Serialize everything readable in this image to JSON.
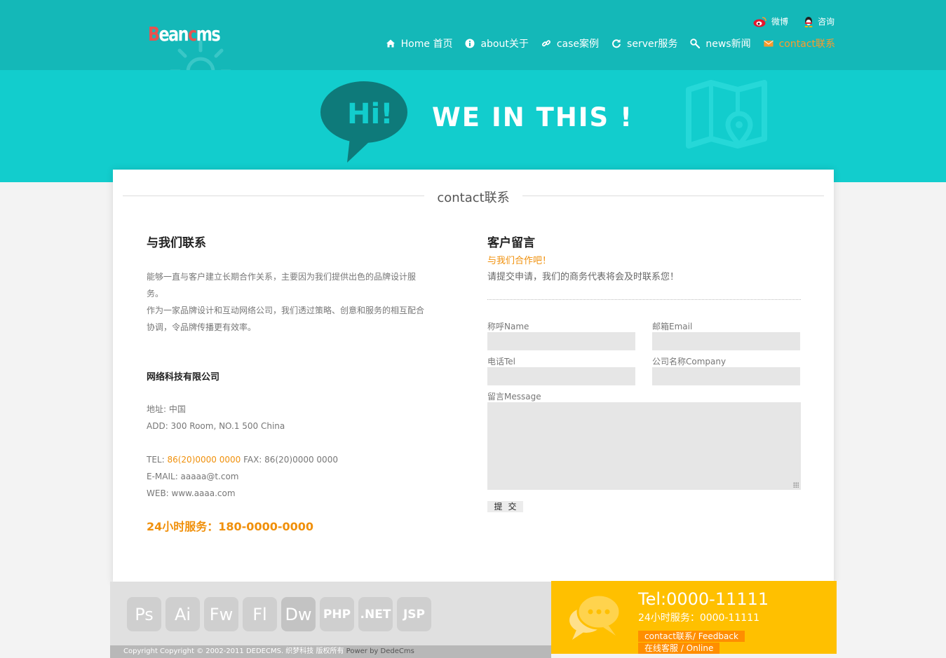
{
  "header": {
    "logo_red_1": "B",
    "logo_white_1": "ean",
    "logo_red_2": "c",
    "logo_white_2": "ms",
    "top_links": [
      {
        "label": "微博",
        "icon": "weibo-icon"
      },
      {
        "label": "咨询",
        "icon": "qq-icon"
      }
    ],
    "nav": [
      {
        "label": "Home 首页",
        "icon": "home-icon"
      },
      {
        "label": "about关于",
        "icon": "info-icon"
      },
      {
        "label": "case案例",
        "icon": "link-icon"
      },
      {
        "label": "server服务",
        "icon": "refresh-icon"
      },
      {
        "label": "news新闻",
        "icon": "search-icon"
      },
      {
        "label": "contact联系",
        "icon": "mail-icon",
        "active": true
      }
    ]
  },
  "banner": {
    "bubble_text": "Hi!",
    "title": "WE IN THIS !"
  },
  "content": {
    "section_title": "contact联系",
    "left": {
      "heading": "与我们联系",
      "para1": "能够一直与客户建立长期合作关系，主要因为我们提供出色的品牌设计服务。",
      "para2": "作为一家品牌设计和互动网络公司，我们透过策略、创意和服务的相互配合协调，令品牌传播更有效率。",
      "company": "网络科技有限公司",
      "address_cn": "地址: 中国",
      "address_en": "ADD: 300 Room, NO.1 500 China",
      "tel_label": "TEL: ",
      "tel_value": "86(20)0000 0000",
      "fax": " FAX: 86(20)0000 0000",
      "email": "E-MAIL: aaaaa@t.com",
      "web": "WEB: www.aaaa.com",
      "hotline": "24小时服务：180-0000-0000"
    },
    "right": {
      "heading": "客户留言",
      "sub_orange": "与我们合作吧！",
      "sub_gray": "请提交申请，我们的商务代表将会及时联系您！",
      "fields": {
        "name": "称呼Name",
        "email": "邮箱Email",
        "tel": "电话Tel",
        "company": "公司名称Company",
        "message": "留言Message"
      },
      "submit": "提交"
    }
  },
  "footer": {
    "tools": [
      "Ps",
      "Ai",
      "Fw",
      "Fl",
      "Dw",
      "PHP",
      ".NET",
      "JSP"
    ],
    "copyright": "Copyright Copyright © 2002-2011 DEDECMS. 织梦科技 版权所有 ",
    "powered": "Power by DedeCms",
    "tel": "Tel:0000-11111",
    "tel_sub": "24小时服务：0000-11111",
    "btn_feedback": "contact联系/ Feedback",
    "btn_online": "在线客服 / Online"
  },
  "colors": {
    "header": "#14b8b8",
    "banner": "#12cdcd",
    "accent_orange": "#f0900b",
    "footer_yellow": "#ffc000",
    "button_orange": "#ff8e00"
  }
}
